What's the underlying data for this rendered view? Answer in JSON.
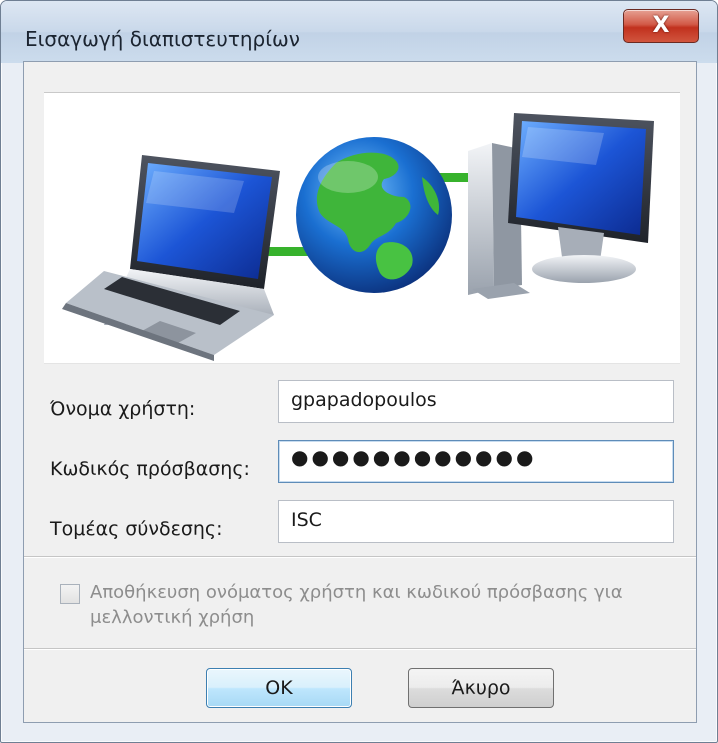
{
  "window": {
    "title": "Εισαγωγή διαπιστευτηρίων",
    "close_glyph": "X"
  },
  "banner": {
    "illustration": [
      "laptop-icon",
      "globe-icon",
      "desktop-computer-icon"
    ]
  },
  "fields": {
    "username": {
      "label": "Όνομα χρήστη:",
      "value": "gpapadopoulos"
    },
    "password": {
      "label": "Κωδικός πρόσβασης:",
      "value": "●●●●●●●●●●●●"
    },
    "domain": {
      "label": "Τομέας σύνδεσης:",
      "value": "ISC"
    }
  },
  "remember": {
    "label": "Αποθήκευση ονόματος χρήστη και κωδικού πρόσβασης για μελλοντική χρήση",
    "checked": false,
    "enabled": false
  },
  "buttons": {
    "ok": "OK",
    "cancel": "Άκυρο"
  },
  "colors": {
    "accent": "#3c7fb1",
    "close": "#c1311e",
    "link_green": "#37b22c"
  }
}
